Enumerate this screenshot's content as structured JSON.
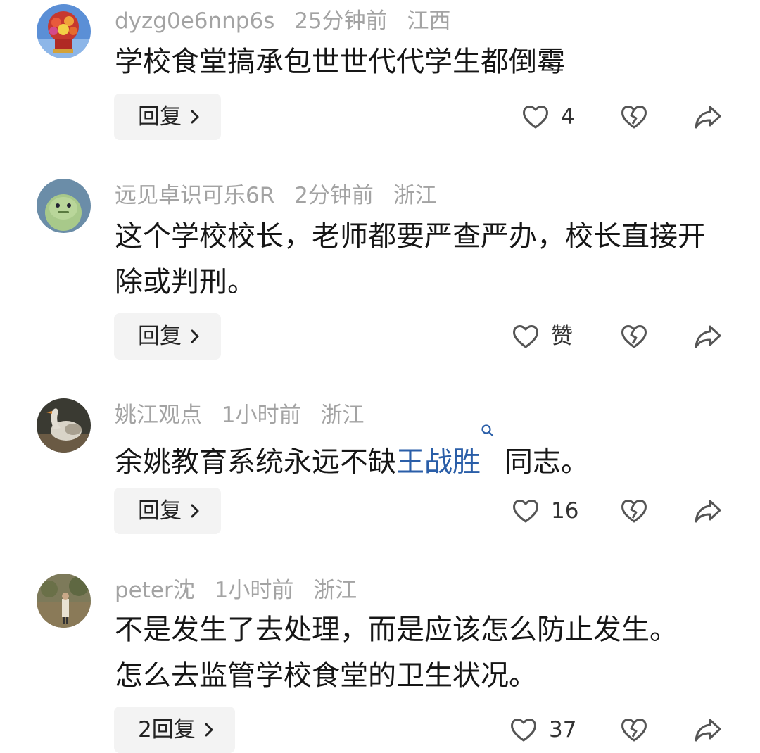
{
  "comments": [
    {
      "username": "dyzg0e6nnp6s",
      "time": "25分钟前",
      "location": "江西",
      "text": "学校食堂搞承包世世代代学生都倒霉",
      "reply_label": "回复",
      "likes": "4",
      "avatar": "flower-basket"
    },
    {
      "username": "远见卓识可乐6R",
      "time": "2分钟前",
      "location": "浙江",
      "text": "这个学校校长，老师都要严查严办，校长直接开除或判刑。",
      "reply_label": "回复",
      "likes": "赞",
      "avatar": "green-frog"
    },
    {
      "username": "姚江观点",
      "time": "1小时前",
      "location": "浙江",
      "text_before": "余姚教育系统永远不缺",
      "text_link": "王战胜",
      "text_after": "同志。",
      "reply_label": "回复",
      "likes": "16",
      "avatar": "goose"
    },
    {
      "username": "peter沈",
      "time": "1小时前",
      "location": "浙江",
      "text": "不是发生了去处理，而是应该怎么防止发生。怎么去监管学校食堂的卫生状况。",
      "reply_label": "2回复",
      "likes": "37",
      "avatar": "person-outdoors"
    }
  ],
  "icons": {
    "like": "heart-outline-icon",
    "dislike": "broken-heart-icon",
    "share": "share-arrow-icon",
    "reply_chevron": "chevron-right-icon",
    "link_search": "search-icon"
  },
  "colors": {
    "meta": "#a3a3a3",
    "text": "#161616",
    "link": "#2a5ea8",
    "button_bg": "#f3f3f3",
    "icon": "#555555"
  }
}
